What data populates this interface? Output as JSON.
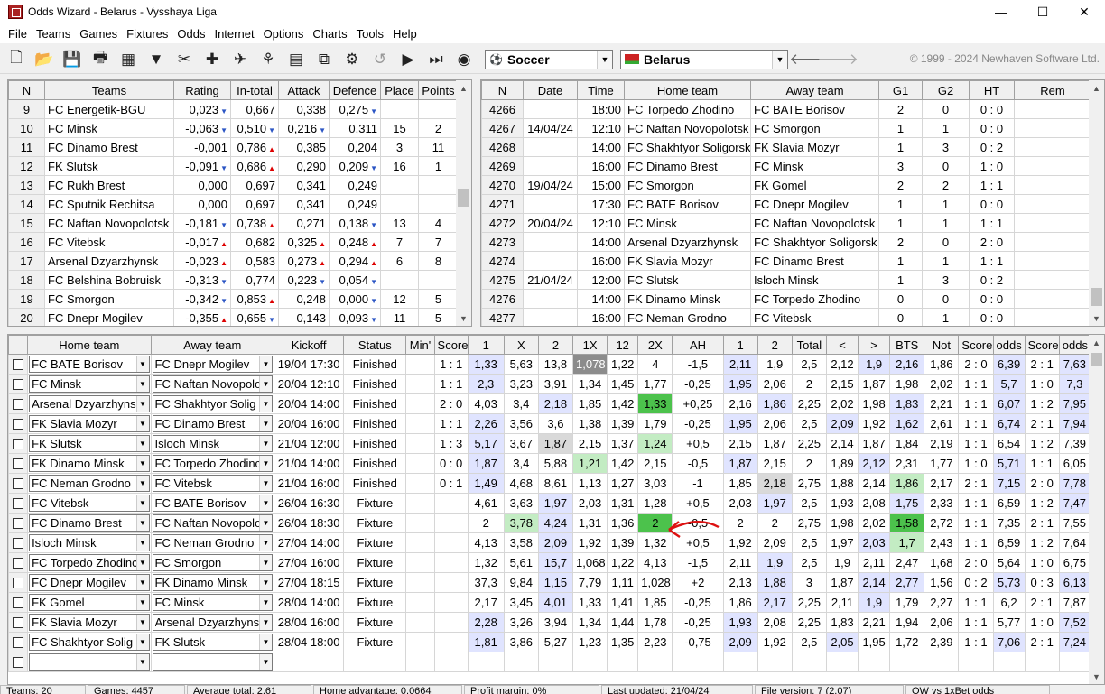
{
  "app": {
    "title": "Odds Wizard - Belarus - Vysshaya Liga",
    "copyright": "© 1999 - 2024 Newhaven Software Ltd."
  },
  "window": {
    "minimize": "—",
    "maximize": "☐",
    "close": "✕"
  },
  "menu": [
    "File",
    "Teams",
    "Games",
    "Fixtures",
    "Odds",
    "Internet",
    "Options",
    "Charts",
    "Tools",
    "Help"
  ],
  "toolbar": {
    "sport": "Soccer",
    "country": "Belarus",
    "icons": [
      "new-file-icon",
      "open-folder-icon",
      "save-icon",
      "print-icon",
      "calculator-icon",
      "filter-icon",
      "tools-icon",
      "add-icon",
      "satellite-icon",
      "chart-icon",
      "spreadsheet-icon",
      "connect-icon",
      "settings-icon",
      "undo-icon",
      "play-icon",
      "fast-forward-icon",
      "ball-icon"
    ]
  },
  "teams": {
    "headers": [
      "N",
      "Teams",
      "Rating",
      "In-total",
      "Attack",
      "Defence",
      "Place",
      "Points"
    ],
    "rows": [
      {
        "n": "9",
        "team": "FC Energetik-BGU",
        "rating": "0,023",
        "ri": "dn",
        "intotal": "0,667",
        "ii": "",
        "attack": "0,338",
        "ai": "",
        "defence": "0,275",
        "di": "dn",
        "place": "",
        "points": ""
      },
      {
        "n": "10",
        "team": "FC Minsk",
        "rating": "-0,063",
        "ri": "dn",
        "intotal": "0,510",
        "ii": "dn",
        "attack": "0,216",
        "ai": "dn",
        "defence": "0,311",
        "di": "",
        "place": "15",
        "points": "2"
      },
      {
        "n": "11",
        "team": "FC Dinamo Brest",
        "rating": "-0,001",
        "ri": "",
        "intotal": "0,786",
        "ii": "up",
        "attack": "0,385",
        "ai": "",
        "defence": "0,204",
        "di": "",
        "place": "3",
        "points": "11"
      },
      {
        "n": "12",
        "team": "FK Slutsk",
        "rating": "-0,091",
        "ri": "dn",
        "intotal": "0,686",
        "ii": "up",
        "attack": "0,290",
        "ai": "",
        "defence": "0,209",
        "di": "dn",
        "place": "16",
        "points": "1"
      },
      {
        "n": "13",
        "team": "FC Rukh Brest",
        "rating": "0,000",
        "ri": "",
        "intotal": "0,697",
        "ii": "",
        "attack": "0,341",
        "ai": "",
        "defence": "0,249",
        "di": "",
        "place": "",
        "points": ""
      },
      {
        "n": "14",
        "team": "FC Sputnik Rechitsa",
        "rating": "0,000",
        "ri": "",
        "intotal": "0,697",
        "ii": "",
        "attack": "0,341",
        "ai": "",
        "defence": "0,249",
        "di": "",
        "place": "",
        "points": ""
      },
      {
        "n": "15",
        "team": "FC Naftan Novopolotsk",
        "rating": "-0,181",
        "ri": "dn",
        "intotal": "0,738",
        "ii": "up",
        "attack": "0,271",
        "ai": "",
        "defence": "0,138",
        "di": "dn",
        "place": "13",
        "points": "4"
      },
      {
        "n": "16",
        "team": "FC Vitebsk",
        "rating": "-0,017",
        "ri": "up",
        "intotal": "0,682",
        "ii": "",
        "attack": "0,325",
        "ai": "up",
        "defence": "0,248",
        "di": "up",
        "place": "7",
        "points": "7"
      },
      {
        "n": "17",
        "team": "Arsenal Dzyarzhynsk",
        "rating": "-0,023",
        "ri": "up",
        "intotal": "0,583",
        "ii": "",
        "attack": "0,273",
        "ai": "up",
        "defence": "0,294",
        "di": "up",
        "place": "6",
        "points": "8"
      },
      {
        "n": "18",
        "team": "FC Belshina Bobruisk",
        "rating": "-0,313",
        "ri": "dn",
        "intotal": "0,774",
        "ii": "",
        "attack": "0,223",
        "ai": "dn",
        "defence": "0,054",
        "di": "dn",
        "place": "",
        "points": ""
      },
      {
        "n": "19",
        "team": "FC Smorgon",
        "rating": "-0,342",
        "ri": "dn",
        "intotal": "0,853",
        "ii": "up",
        "attack": "0,248",
        "ai": "",
        "defence": "0,000",
        "di": "dn",
        "place": "12",
        "points": "5"
      },
      {
        "n": "20",
        "team": "FC Dnepr Mogilev",
        "rating": "-0,355",
        "ri": "up",
        "intotal": "0,655",
        "ii": "dn",
        "attack": "0,143",
        "ai": "",
        "defence": "0,093",
        "di": "dn",
        "place": "11",
        "points": "5"
      }
    ]
  },
  "games": {
    "headers": [
      "N",
      "Date",
      "Time",
      "Home team",
      "Away team",
      "G1",
      "G2",
      "HT",
      "Rem"
    ],
    "rows": [
      {
        "n": "4266",
        "date": "",
        "time": "18:00",
        "home": "FC Torpedo Zhodino",
        "away": "FC BATE Borisov",
        "g1": "2",
        "g2": "0",
        "ht": "0 : 0"
      },
      {
        "n": "4267",
        "date": "14/04/24",
        "time": "12:10",
        "home": "FC Naftan Novopolotsk",
        "away": "FC Smorgon",
        "g1": "1",
        "g2": "1",
        "ht": "0 : 0"
      },
      {
        "n": "4268",
        "date": "",
        "time": "14:00",
        "home": "FC Shakhtyor Soligorsk",
        "away": "FK Slavia Mozyr",
        "g1": "1",
        "g2": "3",
        "ht": "0 : 2"
      },
      {
        "n": "4269",
        "date": "",
        "time": "16:00",
        "home": "FC Dinamo Brest",
        "away": "FC Minsk",
        "g1": "3",
        "g2": "0",
        "ht": "1 : 0"
      },
      {
        "n": "4270",
        "date": "19/04/24",
        "time": "15:00",
        "home": "FC Smorgon",
        "away": "FK Gomel",
        "g1": "2",
        "g2": "2",
        "ht": "1 : 1"
      },
      {
        "n": "4271",
        "date": "",
        "time": "17:30",
        "home": "FC BATE Borisov",
        "away": "FC Dnepr Mogilev",
        "g1": "1",
        "g2": "1",
        "ht": "0 : 0"
      },
      {
        "n": "4272",
        "date": "20/04/24",
        "time": "12:10",
        "home": "FC Minsk",
        "away": "FC Naftan Novopolotsk",
        "g1": "1",
        "g2": "1",
        "ht": "1 : 1"
      },
      {
        "n": "4273",
        "date": "",
        "time": "14:00",
        "home": "Arsenal Dzyarzhynsk",
        "away": "FC Shakhtyor Soligorsk",
        "g1": "2",
        "g2": "0",
        "ht": "2 : 0"
      },
      {
        "n": "4274",
        "date": "",
        "time": "16:00",
        "home": "FK Slavia Mozyr",
        "away": "FC Dinamo Brest",
        "g1": "1",
        "g2": "1",
        "ht": "1 : 1"
      },
      {
        "n": "4275",
        "date": "21/04/24",
        "time": "12:00",
        "home": "FC Slutsk",
        "away": "Isloch Minsk",
        "g1": "1",
        "g2": "3",
        "ht": "0 : 2"
      },
      {
        "n": "4276",
        "date": "",
        "time": "14:00",
        "home": "FK Dinamo Minsk",
        "away": "FC Torpedo Zhodino",
        "g1": "0",
        "g2": "0",
        "ht": "0 : 0"
      },
      {
        "n": "4277",
        "date": "",
        "time": "16:00",
        "home": "FC Neman Grodno",
        "away": "FC Vitebsk",
        "g1": "0",
        "g2": "1",
        "ht": "0 : 0"
      }
    ]
  },
  "fixtures": {
    "headers": [
      "Home team",
      "Away team",
      "Kickoff",
      "Status",
      "Min'",
      "Score",
      "1",
      "X",
      "2",
      "1X",
      "12",
      "2X",
      "AH",
      "1",
      "2",
      "Total",
      "<",
      ">",
      "BTS",
      "Not",
      "Score",
      "odds",
      "Score",
      "odds"
    ],
    "rows": [
      {
        "home": "FC BATE Borisov",
        "away": "FC Dnepr Mogilev",
        "kickoff": "19/04 17:30",
        "status": "Finished",
        "min": "",
        "score": "1 : 1",
        "v": [
          "1,33",
          "5,63",
          "13,8",
          "1,078",
          "1,22",
          "4",
          "-1,5",
          "2,11",
          "1,9",
          "2,5",
          "2,12",
          "1,9",
          "2,16",
          "1,86",
          "2 : 0",
          "6,39",
          "2 : 1",
          "7,63"
        ]
      },
      {
        "home": "FC Minsk",
        "away": "FC Naftan Novopolo",
        "kickoff": "20/04 12:10",
        "status": "Finished",
        "min": "",
        "score": "1 : 1",
        "v": [
          "2,3",
          "3,23",
          "3,91",
          "1,34",
          "1,45",
          "1,77",
          "-0,25",
          "1,95",
          "2,06",
          "2",
          "2,15",
          "1,87",
          "1,98",
          "2,02",
          "1 : 1",
          "5,7",
          "1 : 0",
          "7,3"
        ]
      },
      {
        "home": "Arsenal Dzyarzhyns",
        "away": "FC Shakhtyor Solig",
        "kickoff": "20/04 14:00",
        "status": "Finished",
        "min": "",
        "score": "2 : 0",
        "v": [
          "4,03",
          "3,4",
          "2,18",
          "1,85",
          "1,42",
          "1,33",
          "+0,25",
          "2,16",
          "1,86",
          "2,25",
          "2,02",
          "1,98",
          "1,83",
          "2,21",
          "1 : 1",
          "6,07",
          "1 : 2",
          "7,95"
        ]
      },
      {
        "home": "FK Slavia Mozyr",
        "away": "FC Dinamo Brest",
        "kickoff": "20/04 16:00",
        "status": "Finished",
        "min": "",
        "score": "1 : 1",
        "v": [
          "2,26",
          "3,56",
          "3,6",
          "1,38",
          "1,39",
          "1,79",
          "-0,25",
          "1,95",
          "2,06",
          "2,5",
          "2,09",
          "1,92",
          "1,62",
          "2,61",
          "1 : 1",
          "6,74",
          "2 : 1",
          "7,94"
        ]
      },
      {
        "home": "FK Slutsk",
        "away": "Isloch Minsk",
        "kickoff": "21/04 12:00",
        "status": "Finished",
        "min": "",
        "score": "1 : 3",
        "v": [
          "5,17",
          "3,67",
          "1,87",
          "2,15",
          "1,37",
          "1,24",
          "+0,5",
          "2,15",
          "1,87",
          "2,25",
          "2,14",
          "1,87",
          "1,84",
          "2,19",
          "1 : 1",
          "6,54",
          "1 : 2",
          "7,39"
        ]
      },
      {
        "home": "FK Dinamo Minsk",
        "away": "FC Torpedo Zhodinc",
        "kickoff": "21/04 14:00",
        "status": "Finished",
        "min": "",
        "score": "0 : 0",
        "v": [
          "1,87",
          "3,4",
          "5,88",
          "1,21",
          "1,42",
          "2,15",
          "-0,5",
          "1,87",
          "2,15",
          "2",
          "1,89",
          "2,12",
          "2,31",
          "1,77",
          "1 : 0",
          "5,71",
          "1 : 1",
          "6,05"
        ]
      },
      {
        "home": "FC Neman Grodno",
        "away": "FC Vitebsk",
        "kickoff": "21/04 16:00",
        "status": "Finished",
        "min": "",
        "score": "0 : 1",
        "v": [
          "1,49",
          "4,68",
          "8,61",
          "1,13",
          "1,27",
          "3,03",
          "-1",
          "1,85",
          "2,18",
          "2,75",
          "1,88",
          "2,14",
          "1,86",
          "2,17",
          "2 : 1",
          "7,15",
          "2 : 0",
          "7,78"
        ]
      },
      {
        "home": "FC Vitebsk",
        "away": "FC BATE Borisov",
        "kickoff": "26/04 16:30",
        "status": "Fixture",
        "min": "",
        "score": "",
        "v": [
          "4,61",
          "3,63",
          "1,97",
          "2,03",
          "1,31",
          "1,28",
          "+0,5",
          "2,03",
          "1,97",
          "2,5",
          "1,93",
          "2,08",
          "1,75",
          "2,33",
          "1 : 1",
          "6,59",
          "1 : 2",
          "7,47"
        ]
      },
      {
        "home": "FC Dinamo Brest",
        "away": "FC Naftan Novopolo",
        "kickoff": "26/04 18:30",
        "status": "Fixture",
        "min": "",
        "score": "",
        "v": [
          "2",
          "3,78",
          "4,24",
          "1,31",
          "1,36",
          "2",
          "-0,5",
          "2",
          "2",
          "2,75",
          "1,98",
          "2,02",
          "1,58",
          "2,72",
          "1 : 1",
          "7,35",
          "2 : 1",
          "7,55"
        ]
      },
      {
        "home": "Isloch Minsk",
        "away": "FC Neman Grodno",
        "kickoff": "27/04 14:00",
        "status": "Fixture",
        "min": "",
        "score": "",
        "v": [
          "4,13",
          "3,58",
          "2,09",
          "1,92",
          "1,39",
          "1,32",
          "+0,5",
          "1,92",
          "2,09",
          "2,5",
          "1,97",
          "2,03",
          "1,7",
          "2,43",
          "1 : 1",
          "6,59",
          "1 : 2",
          "7,64"
        ]
      },
      {
        "home": "FC Torpedo Zhodinc",
        "away": "FC Smorgon",
        "kickoff": "27/04 16:00",
        "status": "Fixture",
        "min": "",
        "score": "",
        "v": [
          "1,32",
          "5,61",
          "15,7",
          "1,068",
          "1,22",
          "4,13",
          "-1,5",
          "2,11",
          "1,9",
          "2,5",
          "1,9",
          "2,11",
          "2,47",
          "1,68",
          "2 : 0",
          "5,64",
          "1 : 0",
          "6,75"
        ]
      },
      {
        "home": "FC Dnepr Mogilev",
        "away": "FK Dinamo Minsk",
        "kickoff": "27/04 18:15",
        "status": "Fixture",
        "min": "",
        "score": "",
        "v": [
          "37,3",
          "9,84",
          "1,15",
          "7,79",
          "1,11",
          "1,028",
          "+2",
          "2,13",
          "1,88",
          "3",
          "1,87",
          "2,14",
          "2,77",
          "1,56",
          "0 : 2",
          "5,73",
          "0 : 3",
          "6,13"
        ]
      },
      {
        "home": "FK Gomel",
        "away": "FC Minsk",
        "kickoff": "28/04 14:00",
        "status": "Fixture",
        "min": "",
        "score": "",
        "v": [
          "2,17",
          "3,45",
          "4,01",
          "1,33",
          "1,41",
          "1,85",
          "-0,25",
          "1,86",
          "2,17",
          "2,25",
          "2,11",
          "1,9",
          "1,79",
          "2,27",
          "1 : 1",
          "6,2",
          "2 : 1",
          "7,87"
        ]
      },
      {
        "home": "FK Slavia Mozyr",
        "away": "Arsenal Dzyarzhyns",
        "kickoff": "28/04 16:00",
        "status": "Fixture",
        "min": "",
        "score": "",
        "v": [
          "2,28",
          "3,26",
          "3,94",
          "1,34",
          "1,44",
          "1,78",
          "-0,25",
          "1,93",
          "2,08",
          "2,25",
          "1,83",
          "2,21",
          "1,94",
          "2,06",
          "1 : 1",
          "5,77",
          "1 : 0",
          "7,52"
        ]
      },
      {
        "home": "FC Shakhtyor Solig",
        "away": "FK Slutsk",
        "kickoff": "28/04 18:00",
        "status": "Fixture",
        "min": "",
        "score": "",
        "v": [
          "1,81",
          "3,86",
          "5,27",
          "1,23",
          "1,35",
          "2,23",
          "-0,75",
          "2,09",
          "1,92",
          "2,5",
          "2,05",
          "1,95",
          "1,72",
          "2,39",
          "1 : 1",
          "7,06",
          "2 : 1",
          "7,24"
        ]
      }
    ],
    "highlights": [
      [
        0,
        0,
        "hl"
      ],
      [
        0,
        3,
        "dgy"
      ],
      [
        0,
        7,
        "hl"
      ],
      [
        0,
        11,
        "hl"
      ],
      [
        0,
        12,
        "hl"
      ],
      [
        0,
        15,
        "hl"
      ],
      [
        0,
        17,
        "hl"
      ],
      [
        1,
        0,
        "hl"
      ],
      [
        1,
        7,
        "hl"
      ],
      [
        1,
        15,
        "hl"
      ],
      [
        1,
        17,
        "hl"
      ],
      [
        2,
        2,
        "hl"
      ],
      [
        2,
        5,
        "dg"
      ],
      [
        2,
        8,
        "hl"
      ],
      [
        2,
        12,
        "hl"
      ],
      [
        2,
        15,
        "hl"
      ],
      [
        2,
        17,
        "hl"
      ],
      [
        3,
        0,
        "hl"
      ],
      [
        3,
        7,
        "hl"
      ],
      [
        3,
        10,
        "hl"
      ],
      [
        3,
        12,
        "hl"
      ],
      [
        3,
        15,
        "hl"
      ],
      [
        3,
        17,
        "hl"
      ],
      [
        4,
        0,
        "hl"
      ],
      [
        4,
        2,
        "gy"
      ],
      [
        4,
        5,
        "gr"
      ],
      [
        5,
        0,
        "hl"
      ],
      [
        5,
        3,
        "gr"
      ],
      [
        5,
        7,
        "hl"
      ],
      [
        5,
        11,
        "hl"
      ],
      [
        5,
        15,
        "hl"
      ],
      [
        6,
        0,
        "hl"
      ],
      [
        6,
        8,
        "gy"
      ],
      [
        6,
        12,
        "gr"
      ],
      [
        6,
        15,
        "hl"
      ],
      [
        6,
        17,
        "hl"
      ],
      [
        7,
        2,
        "hl"
      ],
      [
        7,
        8,
        "hl"
      ],
      [
        7,
        12,
        "hl"
      ],
      [
        7,
        17,
        "hl"
      ],
      [
        8,
        1,
        "gr"
      ],
      [
        8,
        2,
        "hl"
      ],
      [
        8,
        5,
        "dg"
      ],
      [
        8,
        12,
        "dg"
      ],
      [
        9,
        2,
        "hl"
      ],
      [
        9,
        11,
        "hl"
      ],
      [
        9,
        12,
        "gr"
      ],
      [
        10,
        2,
        "hl"
      ],
      [
        10,
        8,
        "hl"
      ],
      [
        11,
        2,
        "hl"
      ],
      [
        11,
        8,
        "hl"
      ],
      [
        11,
        11,
        "hl"
      ],
      [
        11,
        12,
        "hl"
      ],
      [
        11,
        15,
        "hl"
      ],
      [
        11,
        17,
        "hl"
      ],
      [
        12,
        2,
        "hl"
      ],
      [
        12,
        8,
        "hl"
      ],
      [
        12,
        11,
        "hl"
      ],
      [
        13,
        0,
        "hl"
      ],
      [
        13,
        7,
        "hl"
      ],
      [
        13,
        17,
        "hl"
      ],
      [
        14,
        0,
        "hl"
      ],
      [
        14,
        7,
        "hl"
      ],
      [
        14,
        10,
        "hl"
      ],
      [
        14,
        15,
        "hl"
      ],
      [
        14,
        17,
        "hl"
      ]
    ]
  },
  "status": [
    "Teams: 20",
    "Games: 4457",
    "Average total: 2,61",
    "Home advantage: 0,0664",
    "Profit margin: 0%",
    "Last updated: 21/04/24",
    "File version: 7 (2.07)",
    "OW vs 1xBet odds"
  ]
}
